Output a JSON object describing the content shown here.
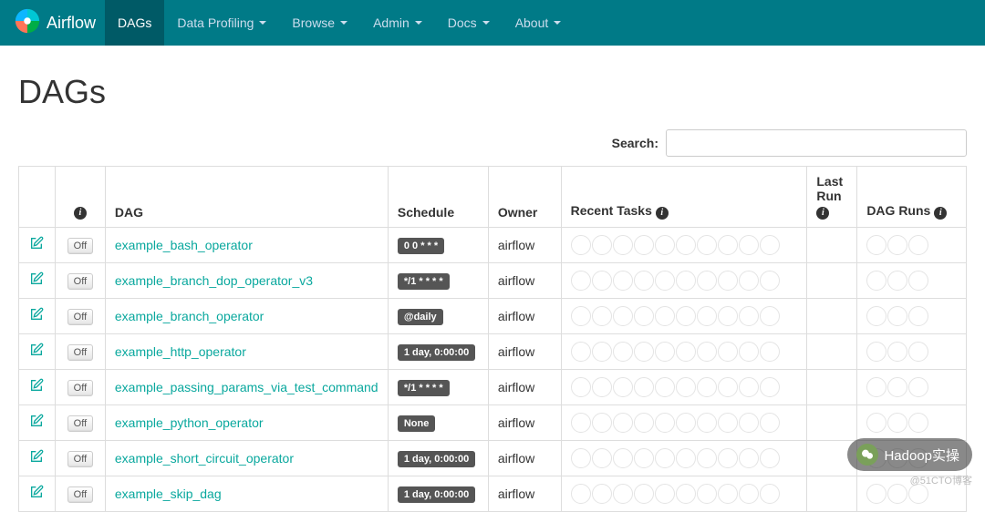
{
  "brand": "Airflow",
  "nav": [
    {
      "label": "DAGs",
      "active": true,
      "dropdown": false
    },
    {
      "label": "Data Profiling",
      "active": false,
      "dropdown": true
    },
    {
      "label": "Browse",
      "active": false,
      "dropdown": true
    },
    {
      "label": "Admin",
      "active": false,
      "dropdown": true
    },
    {
      "label": "Docs",
      "active": false,
      "dropdown": true
    },
    {
      "label": "About",
      "active": false,
      "dropdown": true
    }
  ],
  "page_title": "DAGs",
  "search_label": "Search:",
  "columns": {
    "dag": "DAG",
    "schedule": "Schedule",
    "owner": "Owner",
    "recent_tasks": "Recent Tasks",
    "last_run": "Last Run",
    "dag_runs": "DAG Runs"
  },
  "toggle_off_label": "Off",
  "rows": [
    {
      "dag": "example_bash_operator",
      "schedule": "0 0 * * *",
      "owner": "airflow"
    },
    {
      "dag": "example_branch_dop_operator_v3",
      "schedule": "*/1 * * * *",
      "owner": "airflow"
    },
    {
      "dag": "example_branch_operator",
      "schedule": "@daily",
      "owner": "airflow"
    },
    {
      "dag": "example_http_operator",
      "schedule": "1 day, 0:00:00",
      "owner": "airflow"
    },
    {
      "dag": "example_passing_params_via_test_command",
      "schedule": "*/1 * * * *",
      "owner": "airflow"
    },
    {
      "dag": "example_python_operator",
      "schedule": "None",
      "owner": "airflow"
    },
    {
      "dag": "example_short_circuit_operator",
      "schedule": "1 day, 0:00:00",
      "owner": "airflow"
    },
    {
      "dag": "example_skip_dag",
      "schedule": "1 day, 0:00:00",
      "owner": "airflow"
    }
  ],
  "watermark": {
    "text": "Hadoop实操",
    "caption": "@51CTO博客"
  }
}
